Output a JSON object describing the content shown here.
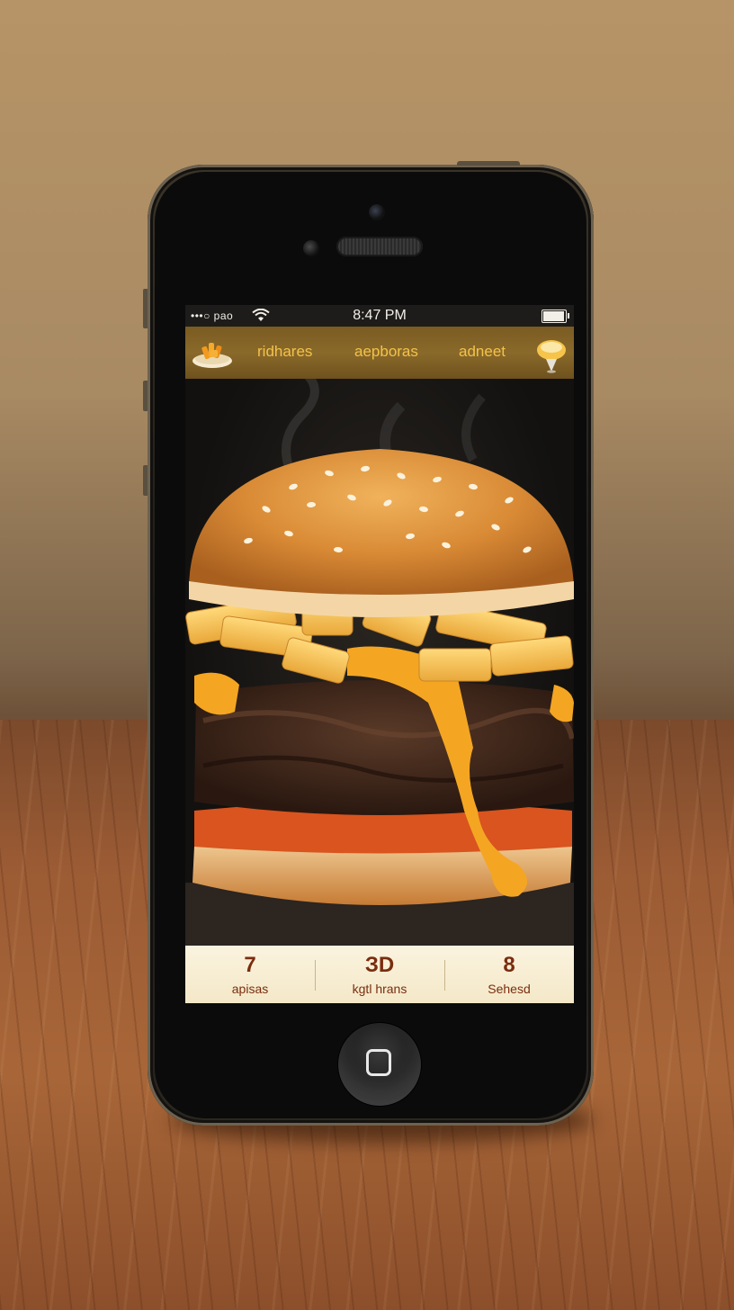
{
  "status_bar": {
    "carrier": "•••○ pao",
    "time": "8:47 PM"
  },
  "nav": {
    "items": [
      {
        "label": "ridhares"
      },
      {
        "label": "aepboras"
      },
      {
        "label": "adneet"
      }
    ],
    "logo_icon": "fries-bowl-icon",
    "right_icon": "bowl-icon"
  },
  "hero": {
    "image": "burger-with-fries-and-cheese"
  },
  "footer": {
    "items": [
      {
        "value": "7",
        "label": "apisas"
      },
      {
        "value": "ЗD",
        "label": "kgtl hrans"
      },
      {
        "value": "8",
        "label": "Sehesd"
      }
    ]
  },
  "colors": {
    "accent": "#f3c24a",
    "nav_bg": "#7a5b22",
    "footer_bg": "#fbf3df",
    "footer_text": "#7a2d0f"
  }
}
